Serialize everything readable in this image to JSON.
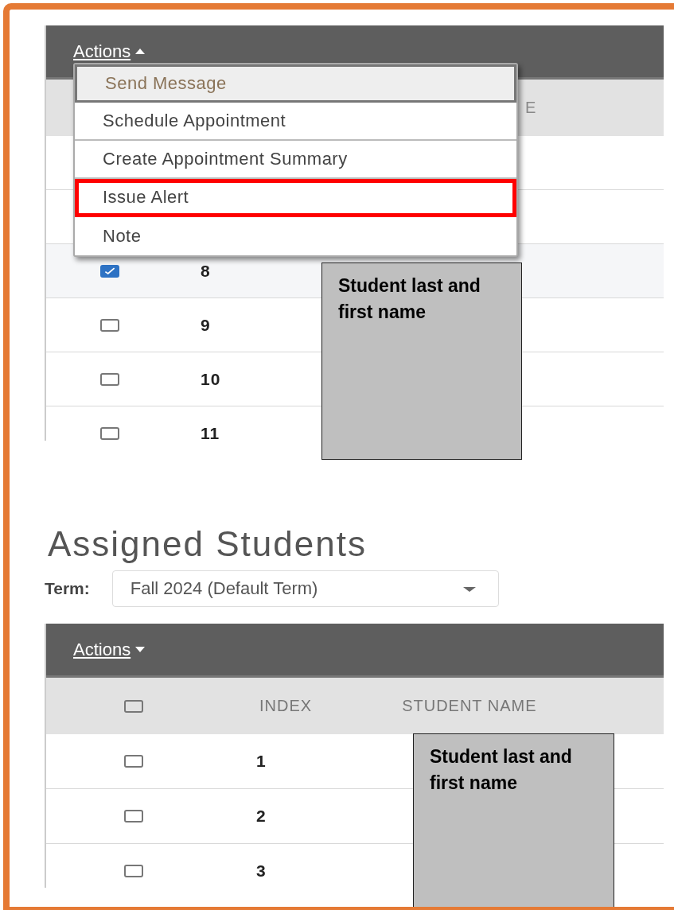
{
  "top_panel": {
    "actions": {
      "label": "Actions",
      "expanded": true
    },
    "header": {
      "column_3": "E"
    },
    "rows": [
      {
        "index": "8",
        "checked": true
      },
      {
        "index": "9",
        "checked": false
      },
      {
        "index": "10",
        "checked": false
      },
      {
        "index": "11",
        "checked": false
      }
    ],
    "menu": [
      {
        "label": "Send Message",
        "hovered": true,
        "outlined": false
      },
      {
        "label": "Schedule Appointment",
        "hovered": false,
        "outlined": false
      },
      {
        "label": "Create Appointment Summary",
        "hovered": false,
        "outlined": false
      },
      {
        "label": "Issue Alert",
        "hovered": false,
        "outlined": true
      },
      {
        "label": "Note",
        "hovered": false,
        "outlined": false
      }
    ],
    "callout": "Student last and first name"
  },
  "title": "Assigned Students",
  "term": {
    "label": "Term:",
    "value": "Fall 2024 (Default Term)"
  },
  "bottom_panel": {
    "actions": {
      "label": "Actions",
      "expanded": false
    },
    "header": {
      "select_all_checked": false,
      "columns": [
        "INDEX",
        "STUDENT NAME"
      ]
    },
    "rows": [
      {
        "index": "1",
        "checked": false
      },
      {
        "index": "2",
        "checked": false
      },
      {
        "index": "3",
        "checked": false
      }
    ],
    "callout": "Student last and first name"
  }
}
